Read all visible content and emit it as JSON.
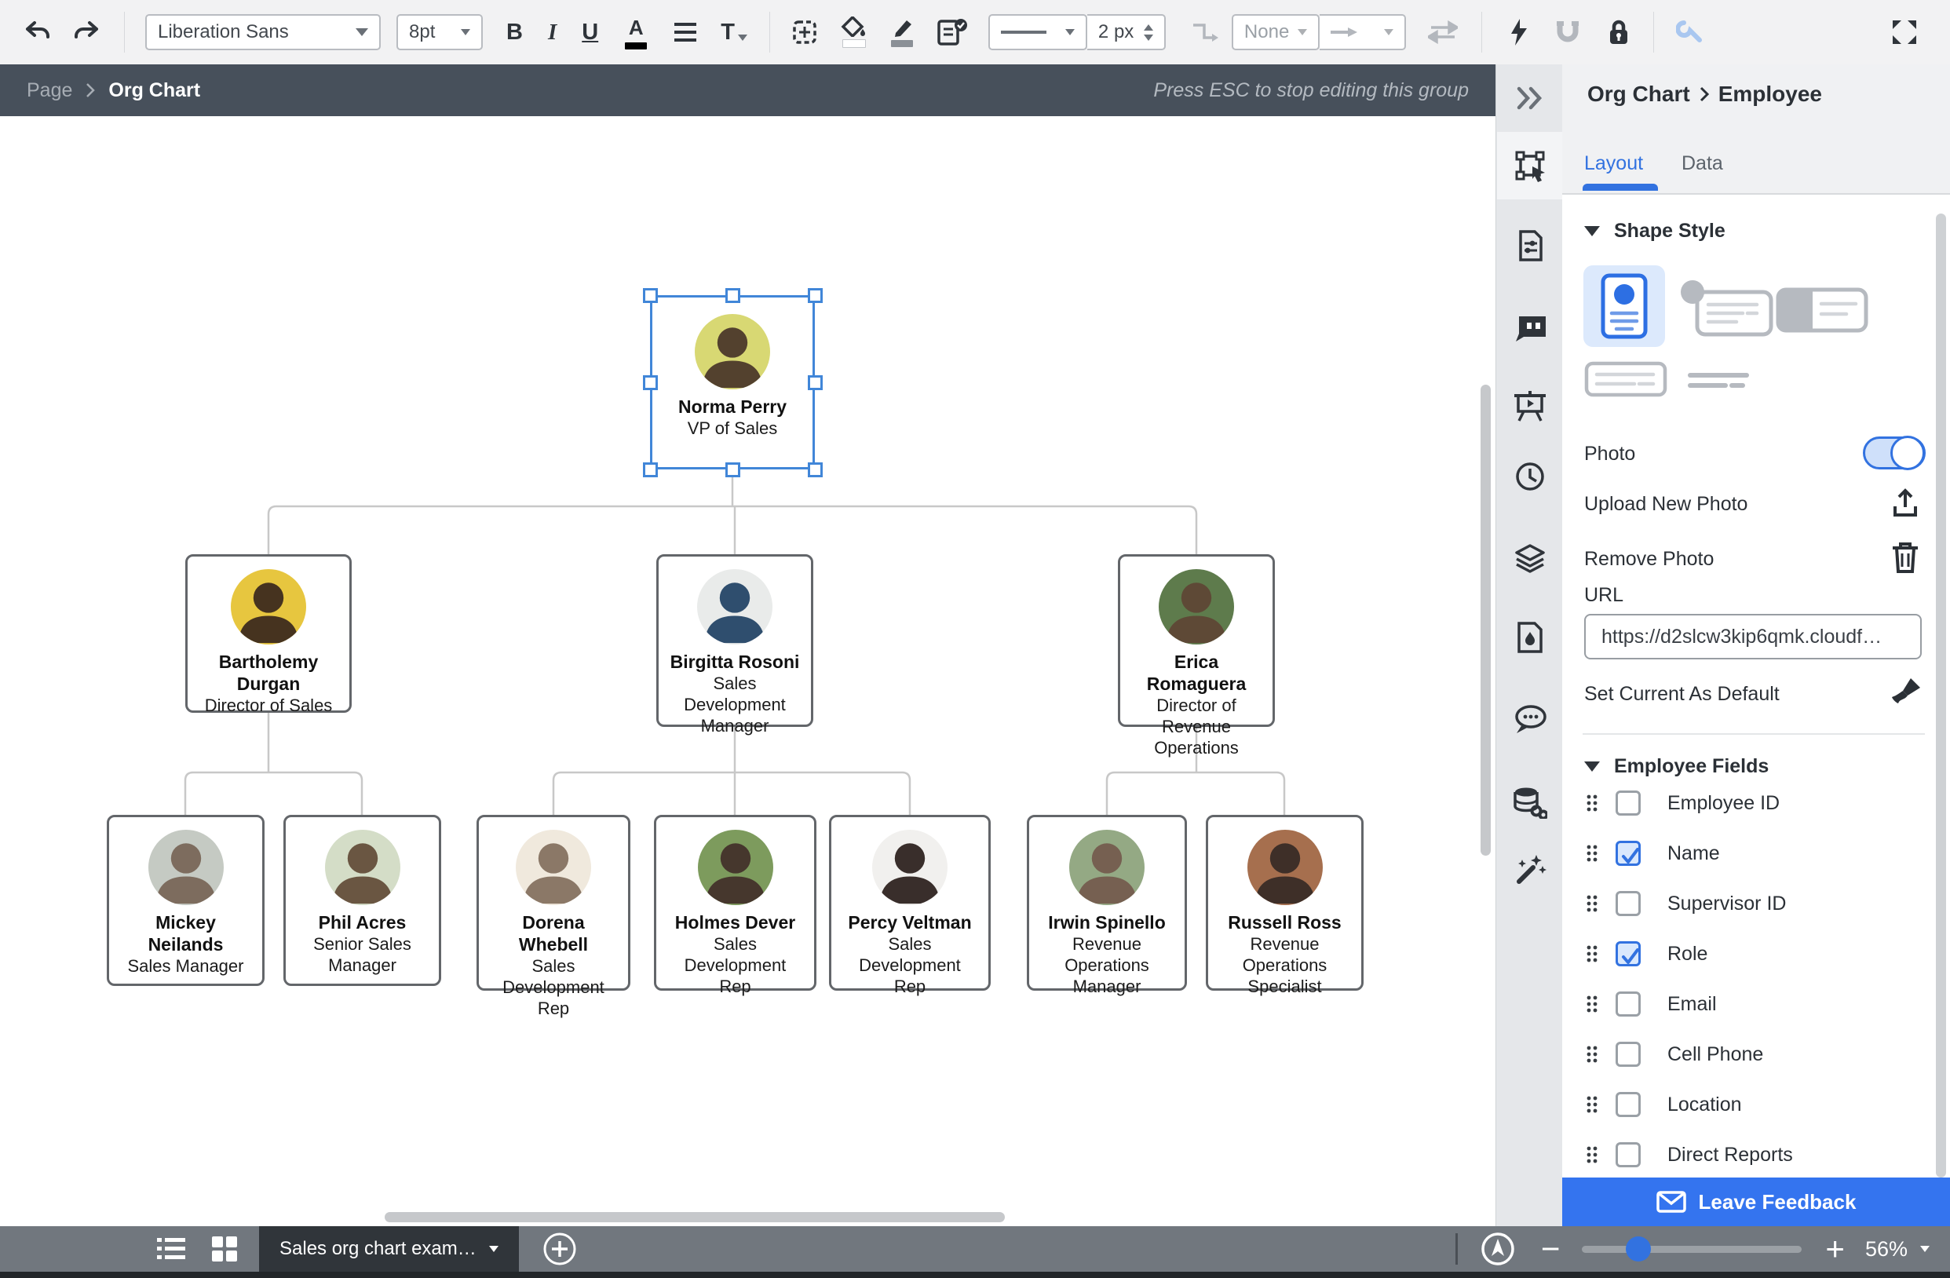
{
  "toolbar": {
    "font_value": "Liberation Sans",
    "size_value": "8pt",
    "bold": "B",
    "italic": "I",
    "underline": "U",
    "text_color": "A",
    "text_style": "T",
    "line_weight": "2 px",
    "connector_style": "None"
  },
  "breadcrumb": {
    "page": "Page",
    "group": "Org Chart",
    "hint": "Press ESC to stop editing this group"
  },
  "side_panel": {
    "title": [
      "Org Chart",
      "Employee"
    ],
    "tabs": [
      {
        "label": "Layout",
        "active": true
      },
      {
        "label": "Data",
        "active": false
      }
    ],
    "shape_style_title": "Shape Style",
    "photo_label": "Photo",
    "photo_on": true,
    "upload_label": "Upload New Photo",
    "remove_label": "Remove Photo",
    "url_label": "URL",
    "url_value": "https://d2slcw3kip6qmk.cloudf…",
    "set_default_label": "Set Current As Default",
    "fields_title": "Employee Fields",
    "fields": [
      {
        "label": "Employee ID",
        "checked": false
      },
      {
        "label": "Name",
        "checked": true
      },
      {
        "label": "Supervisor ID",
        "checked": false
      },
      {
        "label": "Role",
        "checked": true
      },
      {
        "label": "Email",
        "checked": false
      },
      {
        "label": "Cell Phone",
        "checked": false
      },
      {
        "label": "Location",
        "checked": false
      },
      {
        "label": "Direct Reports",
        "checked": false
      }
    ],
    "feedback_label": "Leave Feedback"
  },
  "bottom_bar": {
    "page_tab": "Sales org chart exam…",
    "zoom_value": "56%"
  },
  "org_chart": {
    "nodes": [
      {
        "id": "norma",
        "name": "Norma Perry",
        "role": "VP of Sales",
        "parent": null,
        "selected": true,
        "avatar_bg": "#d8d873",
        "avatar_fg": "#53412e"
      },
      {
        "id": "bart",
        "name": "Bartholemy Durgan",
        "role": "Director of Sales",
        "parent": "norma",
        "selected": false,
        "avatar_bg": "#e7c63f",
        "avatar_fg": "#46331f"
      },
      {
        "id": "birgitta",
        "name": "Birgitta Rosoni",
        "role": "Sales Development Manager",
        "parent": "norma",
        "selected": false,
        "avatar_bg": "#e9ebea",
        "avatar_fg": "#2f4e6e"
      },
      {
        "id": "erica",
        "name": "Erica Romaguera",
        "role": "Director of Revenue Operations",
        "parent": "norma",
        "selected": false,
        "avatar_bg": "#5e7b4c",
        "avatar_fg": "#5e4936"
      },
      {
        "id": "mickey",
        "name": "Mickey Neilands",
        "role": "Sales Manager",
        "parent": "bart",
        "selected": false,
        "avatar_bg": "#c5cac3",
        "avatar_fg": "#7d6c5e"
      },
      {
        "id": "phil",
        "name": "Phil Acres",
        "role": "Senior Sales Manager",
        "parent": "bart",
        "selected": false,
        "avatar_bg": "#d4ddc7",
        "avatar_fg": "#6a5642"
      },
      {
        "id": "dorena",
        "name": "Dorena Whebell",
        "role": "Sales Development Rep",
        "parent": "birgitta",
        "selected": false,
        "avatar_bg": "#f0e9dd",
        "avatar_fg": "#8b7867"
      },
      {
        "id": "holmes",
        "name": "Holmes Dever",
        "role": "Sales Development Rep",
        "parent": "birgitta",
        "selected": false,
        "avatar_bg": "#7d9b5d",
        "avatar_fg": "#46372d"
      },
      {
        "id": "percy",
        "name": "Percy Veltman",
        "role": "Sales Development Rep",
        "parent": "birgitta",
        "selected": false,
        "avatar_bg": "#f1f0ee",
        "avatar_fg": "#392e2b"
      },
      {
        "id": "irwin",
        "name": "Irwin Spinello",
        "role": "Revenue Operations Manager",
        "parent": "erica",
        "selected": false,
        "avatar_bg": "#94a984",
        "avatar_fg": "#766051"
      },
      {
        "id": "russell",
        "name": "Russell Ross",
        "role": "Revenue Operations Specialist",
        "parent": "erica",
        "selected": false,
        "avatar_bg": "#a66f4e",
        "avatar_fg": "#3e2f28"
      }
    ]
  },
  "colors": {
    "accent": "#3272e0",
    "selection": "#4186d8",
    "connector": "#c8c8c8"
  }
}
